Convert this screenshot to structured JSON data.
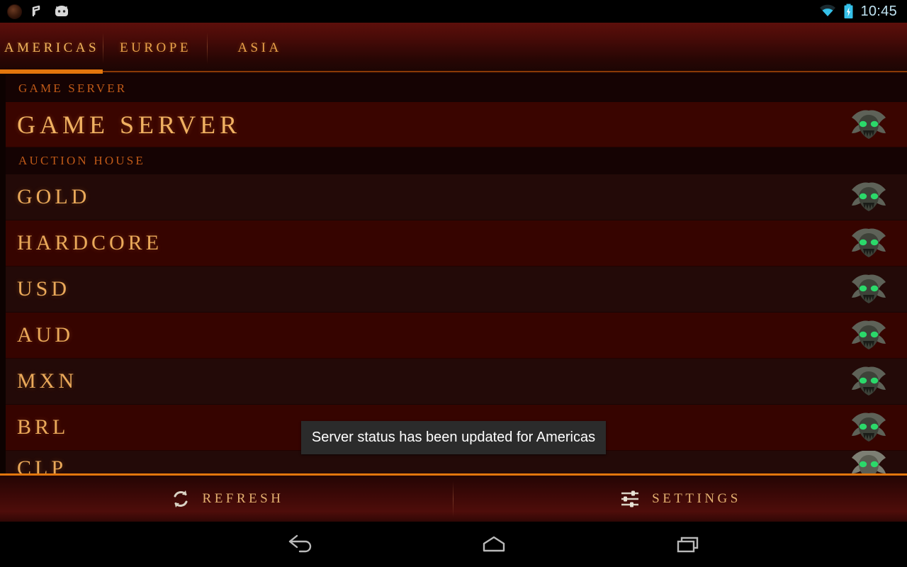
{
  "statusbar": {
    "time": "10:45",
    "icons": [
      "app-notification-icon",
      "music-note-icon",
      "android-head-icon",
      "wifi-icon",
      "battery-charging-icon"
    ]
  },
  "tabs": [
    {
      "label": "AMERICAS",
      "active": true
    },
    {
      "label": "EUROPE",
      "active": false
    },
    {
      "label": "ASIA",
      "active": false
    }
  ],
  "sections": [
    {
      "header": "GAME SERVER",
      "rows": [
        {
          "label": "GAME SERVER",
          "style": "highlight",
          "status_icon": "demon-skull-icon"
        }
      ]
    },
    {
      "header": "AUCTION HOUSE",
      "rows": [
        {
          "label": "GOLD",
          "style": "dark",
          "status_icon": "demon-skull-icon"
        },
        {
          "label": "HARDCORE",
          "style": "light",
          "status_icon": "demon-skull-icon"
        },
        {
          "label": "USD",
          "style": "dark",
          "status_icon": "demon-skull-icon"
        },
        {
          "label": "AUD",
          "style": "light",
          "status_icon": "demon-skull-icon"
        },
        {
          "label": "MXN",
          "style": "dark",
          "status_icon": "demon-skull-icon"
        },
        {
          "label": "BRL",
          "style": "light",
          "status_icon": "demon-skull-icon"
        },
        {
          "label": "CLP",
          "style": "clipped",
          "status_icon": "demon-skull-icon"
        }
      ]
    }
  ],
  "toast": {
    "message": "Server status has been updated for Americas"
  },
  "bottombar": {
    "refresh_label": "REFRESH",
    "settings_label": "SETTINGS"
  },
  "navbar": {
    "back": "back-icon",
    "home": "home-icon",
    "recents": "recents-icon"
  },
  "colors": {
    "accent_orange": "#e2760d",
    "gold_text": "#eaa95a",
    "header_orange": "#c05a18",
    "row_dark": "#230a08",
    "row_light": "#360400",
    "row_highlight": "#3a0500",
    "status_time": "#bfe3f2"
  }
}
